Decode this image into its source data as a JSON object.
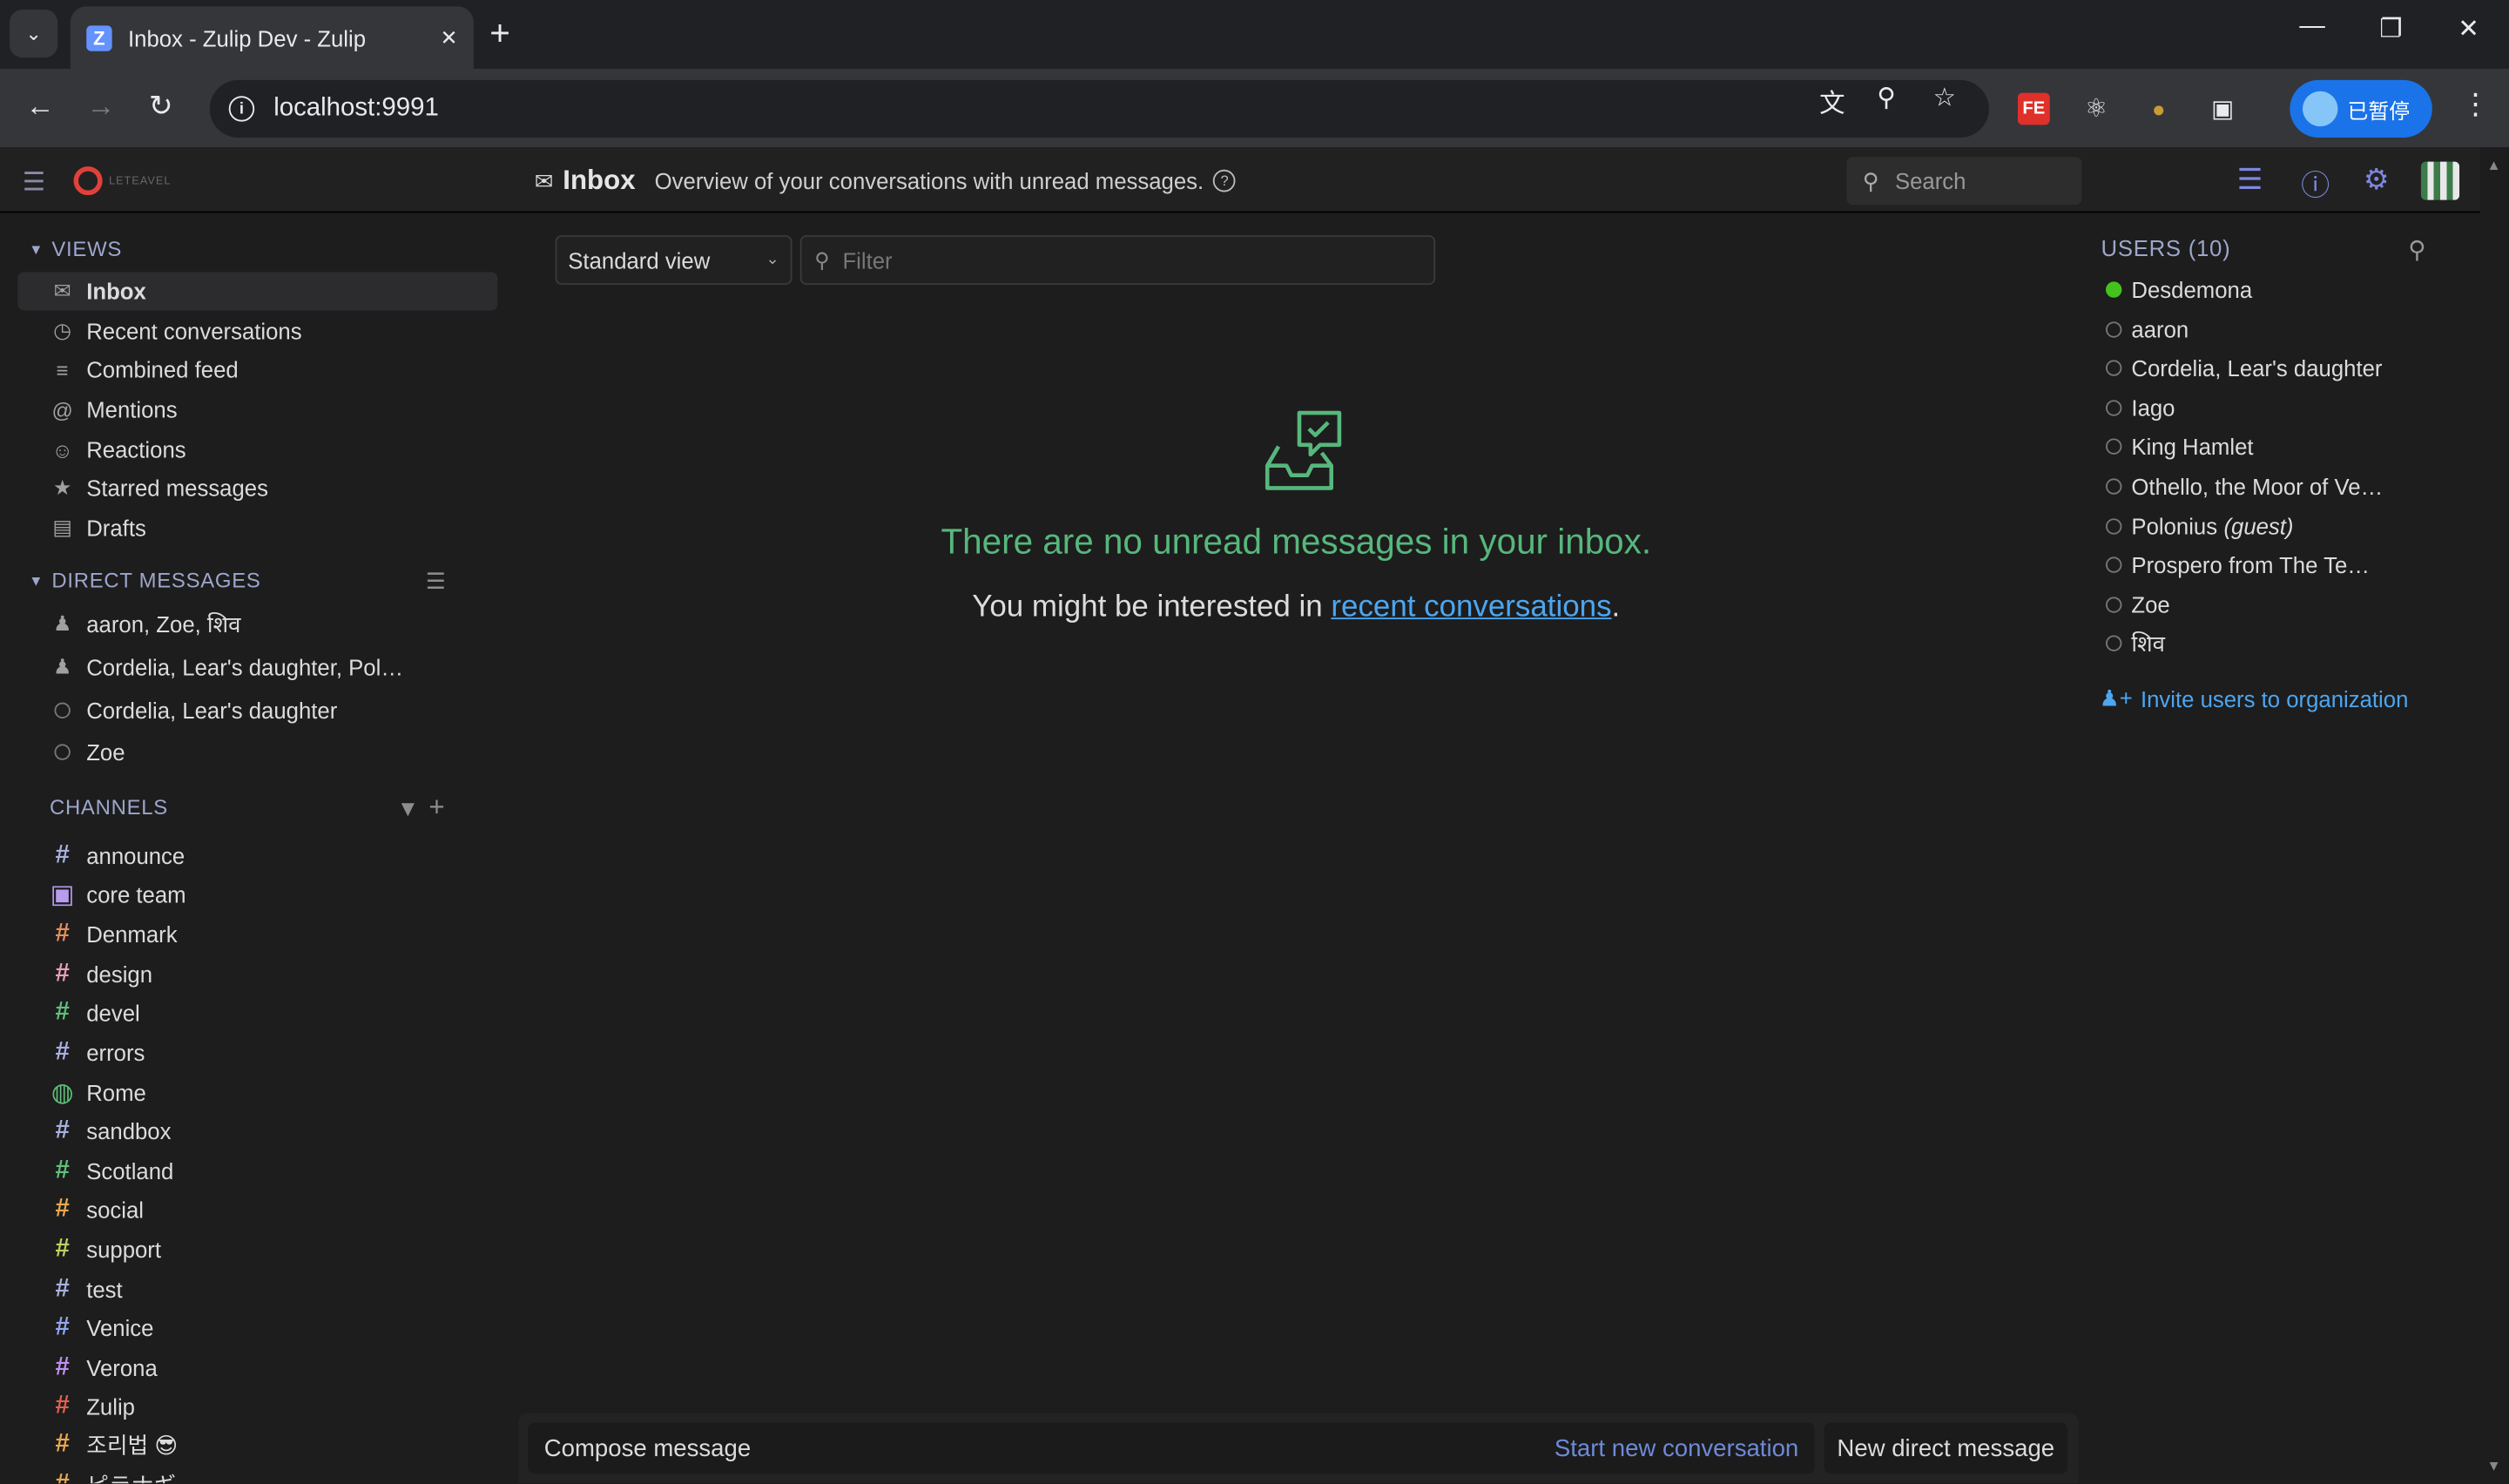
{
  "browser": {
    "tab_title": "Inbox - Zulip Dev - Zulip",
    "url": "localhost:9991",
    "profile_label": "已暂停",
    "ext_fe_label": "FE"
  },
  "header": {
    "title": "Inbox",
    "description": "Overview of your conversations with unread messages.",
    "search_placeholder": "Search",
    "logo_text": "LETEAVEL"
  },
  "sidebar": {
    "views_heading": "VIEWS",
    "views": [
      {
        "label": "Inbox",
        "icon": "inbox-icon"
      },
      {
        "label": "Recent conversations",
        "icon": "clock-icon"
      },
      {
        "label": "Combined feed",
        "icon": "feed-icon"
      },
      {
        "label": "Mentions",
        "icon": "at-icon"
      },
      {
        "label": "Reactions",
        "icon": "smile-icon"
      },
      {
        "label": "Starred messages",
        "icon": "star-icon"
      },
      {
        "label": "Drafts",
        "icon": "drafts-icon"
      }
    ],
    "dm_heading": "DIRECT MESSAGES",
    "dms": [
      {
        "label": "aaron, Zoe, शिव",
        "type": "group"
      },
      {
        "label": "Cordelia, Lear's daughter, Pol…",
        "type": "group"
      },
      {
        "label": "Cordelia, Lear's daughter",
        "type": "user"
      },
      {
        "label": "Zoe",
        "type": "user"
      }
    ],
    "channels_heading": "CHANNELS",
    "channels": [
      {
        "label": "announce",
        "color": "#a8b0e0",
        "kind": "hash"
      },
      {
        "label": "core team",
        "color": "#b89cf0",
        "kind": "lock"
      },
      {
        "label": "Denmark",
        "color": "#e68d5c",
        "kind": "hash"
      },
      {
        "label": "design",
        "color": "#e8a0b8",
        "kind": "hash"
      },
      {
        "label": "devel",
        "color": "#5fc07a",
        "kind": "hash"
      },
      {
        "label": "errors",
        "color": "#a8b0e0",
        "kind": "hash"
      },
      {
        "label": "Rome",
        "color": "#5fc07a",
        "kind": "globe"
      },
      {
        "label": "sandbox",
        "color": "#a8b0e0",
        "kind": "hash"
      },
      {
        "label": "Scotland",
        "color": "#5fc07a",
        "kind": "hash"
      },
      {
        "label": "social",
        "color": "#e8a850",
        "kind": "hash"
      },
      {
        "label": "support",
        "color": "#c0d060",
        "kind": "hash"
      },
      {
        "label": "test",
        "color": "#a8b0e0",
        "kind": "hash"
      },
      {
        "label": "Venice",
        "color": "#90a8f0",
        "kind": "hash"
      },
      {
        "label": "Verona",
        "color": "#c090f0",
        "kind": "hash"
      },
      {
        "label": "Zulip",
        "color": "#e06050",
        "kind": "hash"
      },
      {
        "label": "조리법 😎",
        "color": "#e8a850",
        "kind": "hash"
      },
      {
        "label": "ピラナギ…",
        "color": "#e8a850",
        "kind": "hash"
      }
    ]
  },
  "main": {
    "view_select": "Standard view",
    "filter_placeholder": "Filter",
    "empty_title": "There are no unread messages in your inbox.",
    "empty_sub_prefix": "You might be interested in ",
    "empty_sub_link": "recent conversations",
    "empty_sub_suffix": "."
  },
  "compose": {
    "compose_label": "Compose message",
    "new_conversation_label": "Start new conversation",
    "new_dm_label": "New direct message"
  },
  "users": {
    "heading": "USERS (10)",
    "list": [
      {
        "name": "Desdemona",
        "online": true,
        "guest": ""
      },
      {
        "name": "aaron",
        "online": false,
        "guest": ""
      },
      {
        "name": "Cordelia, Lear's daughter",
        "online": false,
        "guest": ""
      },
      {
        "name": "Iago",
        "online": false,
        "guest": ""
      },
      {
        "name": "King Hamlet",
        "online": false,
        "guest": ""
      },
      {
        "name": "Othello, the Moor of Ve…",
        "online": false,
        "guest": ""
      },
      {
        "name": "Polonius",
        "online": false,
        "guest": "(guest)"
      },
      {
        "name": "Prospero from The Te…",
        "online": false,
        "guest": ""
      },
      {
        "name": "Zoe",
        "online": false,
        "guest": ""
      },
      {
        "name": "शिव",
        "online": false,
        "guest": ""
      }
    ],
    "invite_label": "Invite users to organization"
  }
}
